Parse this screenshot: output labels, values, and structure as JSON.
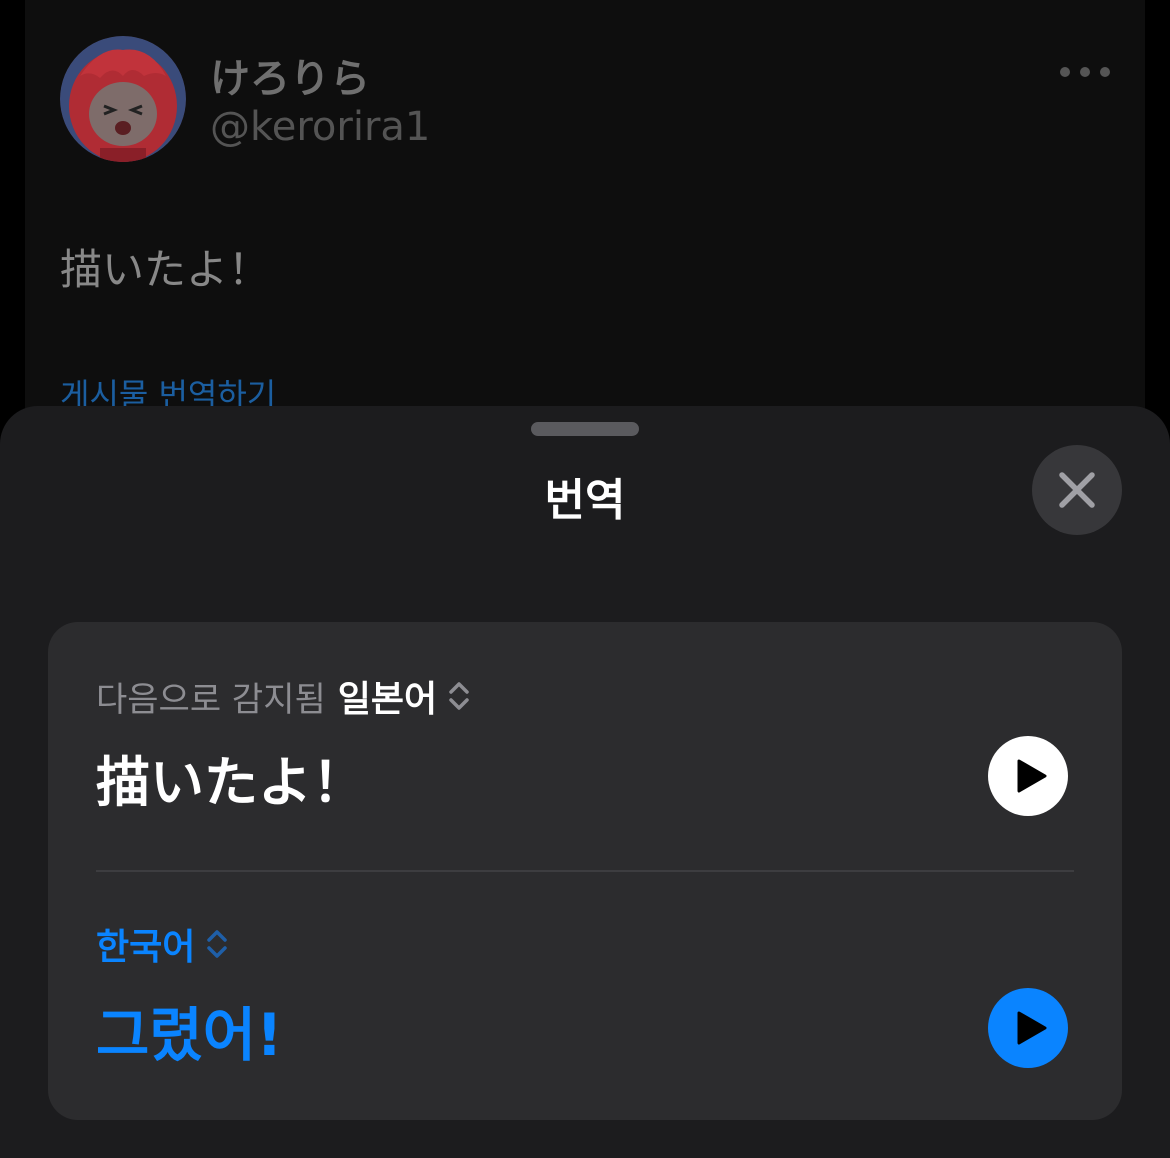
{
  "tweet": {
    "display_name": "けろりら",
    "handle": "@kerorira1",
    "text": "描いたよ！",
    "translate_link": "게시물 번역하기"
  },
  "sheet": {
    "title": "번역",
    "close_icon": "xmark-icon",
    "source": {
      "detected_label": "다음으로 감지됨",
      "language": "일본어",
      "text": "描いたよ！",
      "play_icon": "play-icon"
    },
    "target": {
      "language": "한국어",
      "text": "그렸어!",
      "play_icon": "play-icon"
    }
  },
  "colors": {
    "accent": "#0a84ff",
    "sheet_bg": "#1c1c1e",
    "card_bg": "#2c2c2e"
  }
}
